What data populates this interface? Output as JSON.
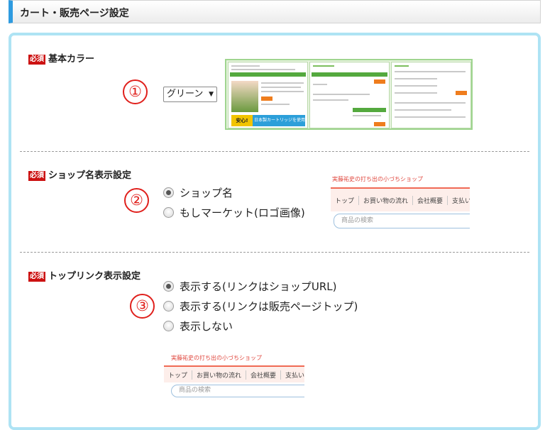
{
  "header": {
    "title": "カート・販売ページ設定"
  },
  "required_tag": "必須",
  "accent_colors": {
    "header_bar": "#2f9be0",
    "panel_border": "#aee3f4",
    "required": "#cc1111",
    "step_number": "#e0201c"
  },
  "sections": {
    "base_color": {
      "label": "基本カラー",
      "step": "①",
      "select_value": "グリーン",
      "preview_banner": "日本製カートリッジを使用!",
      "preview_badge": "安心!"
    },
    "shop_name": {
      "label": "ショップ名表示設定",
      "step": "②",
      "options": [
        {
          "label": "ショップ名",
          "checked": true
        },
        {
          "label": "もしマーケット(ロゴ画像)",
          "checked": false
        }
      ],
      "preview": {
        "shop_name": "実藤祐史の打ち出の小づちショップ",
        "nav": [
          "トップ",
          "お買い物の流れ",
          "会社概要",
          "支払い・配"
        ],
        "search_placeholder": "商品の検索"
      }
    },
    "top_link": {
      "label": "トップリンク表示設定",
      "step": "③",
      "options": [
        {
          "label": "表示する(リンクはショップURL)",
          "checked": true
        },
        {
          "label": "表示する(リンクは販売ページトップ)",
          "checked": false
        },
        {
          "label": "表示しない",
          "checked": false
        }
      ],
      "preview": {
        "shop_name": "実藤祐史の打ち出の小づちショップ",
        "nav": [
          "トップ",
          "お買い物の流れ",
          "会社概要",
          "支払い・配送について"
        ],
        "search_placeholder": "商品の検索"
      }
    }
  }
}
